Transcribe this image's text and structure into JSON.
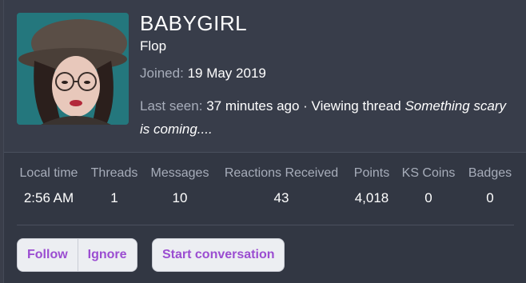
{
  "profile": {
    "username": "BABYGIRL",
    "user_title": "Flop",
    "joined_label": "Joined:",
    "joined_value": "19 May 2019",
    "last_seen_label": "Last seen:",
    "last_seen_value": "37 minutes ago · Viewing thread",
    "thread_title": "Something scary is coming...."
  },
  "stats": [
    {
      "label": "Local time",
      "value": "2:56 AM"
    },
    {
      "label": "Threads",
      "value": "1"
    },
    {
      "label": "Messages",
      "value": "10"
    },
    {
      "label": "Reactions Received",
      "value": "43"
    },
    {
      "label": "Points",
      "value": "4,018"
    },
    {
      "label": "KS Coins",
      "value": "0"
    },
    {
      "label": "Badges",
      "value": "0"
    }
  ],
  "actions": {
    "follow": "Follow",
    "ignore": "Ignore",
    "start_conversation": "Start conversation"
  },
  "colors": {
    "card_bg": "#323743",
    "header_bg": "#383d4a",
    "muted_text": "#a7adba",
    "button_text": "#9b4dd1",
    "button_bg": "#eceef2"
  }
}
